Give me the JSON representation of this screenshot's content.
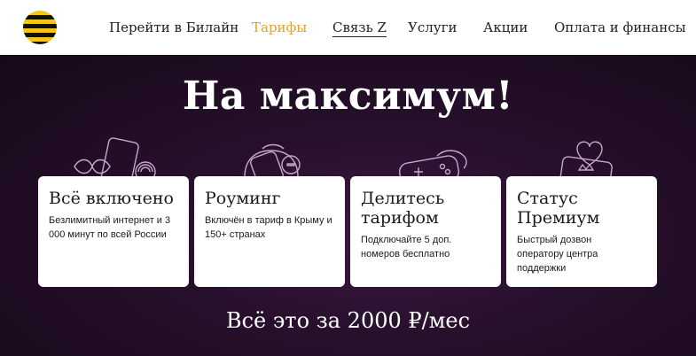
{
  "header": {
    "logo_name": "beeline-logo",
    "nav": [
      {
        "label": "Перейти в Билайн"
      },
      {
        "label": "Тарифы"
      },
      {
        "label": "Связь Z"
      },
      {
        "label": "Услуги"
      },
      {
        "label": "Акции"
      },
      {
        "label": "Оплата и финансы"
      }
    ]
  },
  "hero": {
    "title": "На максимум!",
    "price": "Всё это за 2000 ₽/мес"
  },
  "cards": [
    {
      "title": "Всё включено",
      "text": "Безлимитный интернет и 3 000 минут по всей России"
    },
    {
      "title": "Роуминг",
      "text": "Включён в тариф в Крыму и 150+ странах"
    },
    {
      "title": "Делитесь тарифом",
      "text": "Подключайте 5 доп. номеров бесплатно"
    },
    {
      "title": "Статус Премиум",
      "text": "Быстрый дозвон оператору центра поддержки"
    }
  ],
  "colors": {
    "accent": "#e8a21b",
    "brand_yellow": "#f5c518",
    "hero_bg": "#27102c",
    "card_bg": "#ffffff"
  },
  "icons": [
    "phone-infinity-icon",
    "phone-location-icon",
    "gamepad-icon",
    "phone-heart-crown-icon"
  ]
}
